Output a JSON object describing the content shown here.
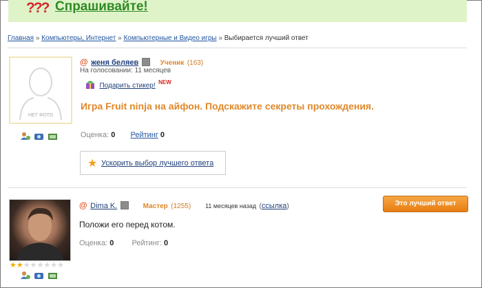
{
  "banner": {
    "logo_glyph": "???",
    "title": "Спрашивайте!"
  },
  "breadcrumb": {
    "items": [
      "Главная",
      "Компьютеры, Интернет",
      "Компьютерные и Видео игры"
    ],
    "current": "Выбирается лучший ответ",
    "separator": "»"
  },
  "question_block": {
    "avatar_placeholder": "НЕТ ФОТО",
    "at_sign": "@",
    "username": "женя беляев",
    "rank": "Ученик",
    "rank_points": "(163)",
    "voting_status": "На голосовании: 11 месяцев",
    "gift_link": "Подарить стикер!",
    "new_badge": "NEW",
    "question_text": "Игра Fruit ninja на айфон. Подскажите секреты прохождения.",
    "score_label": "Оценка:",
    "score_value": "0",
    "rating_label": "Рейтинг",
    "rating_value": "0",
    "hasten_link": "Ускорить выбор лучшего ответа"
  },
  "answer_block": {
    "at_sign": "@",
    "username": "Dima K.",
    "rank": "Мастер",
    "rank_points": "(1255)",
    "time_ago": "11 месяцев назад",
    "link_text": "ссылка",
    "best_button": "Это лучший ответ",
    "answer_text": "Положи его перед котом.",
    "score_label": "Оценка:",
    "score_value": "0",
    "rating_label": "Рейтинг:",
    "rating_value": "0",
    "stars_filled": 2,
    "stars_total": 8
  },
  "colors": {
    "banner_bg": "#dff3c9",
    "accent_orange": "#e0882a",
    "link_blue": "#1f3f7a",
    "button_orange": "#f08c1e"
  }
}
